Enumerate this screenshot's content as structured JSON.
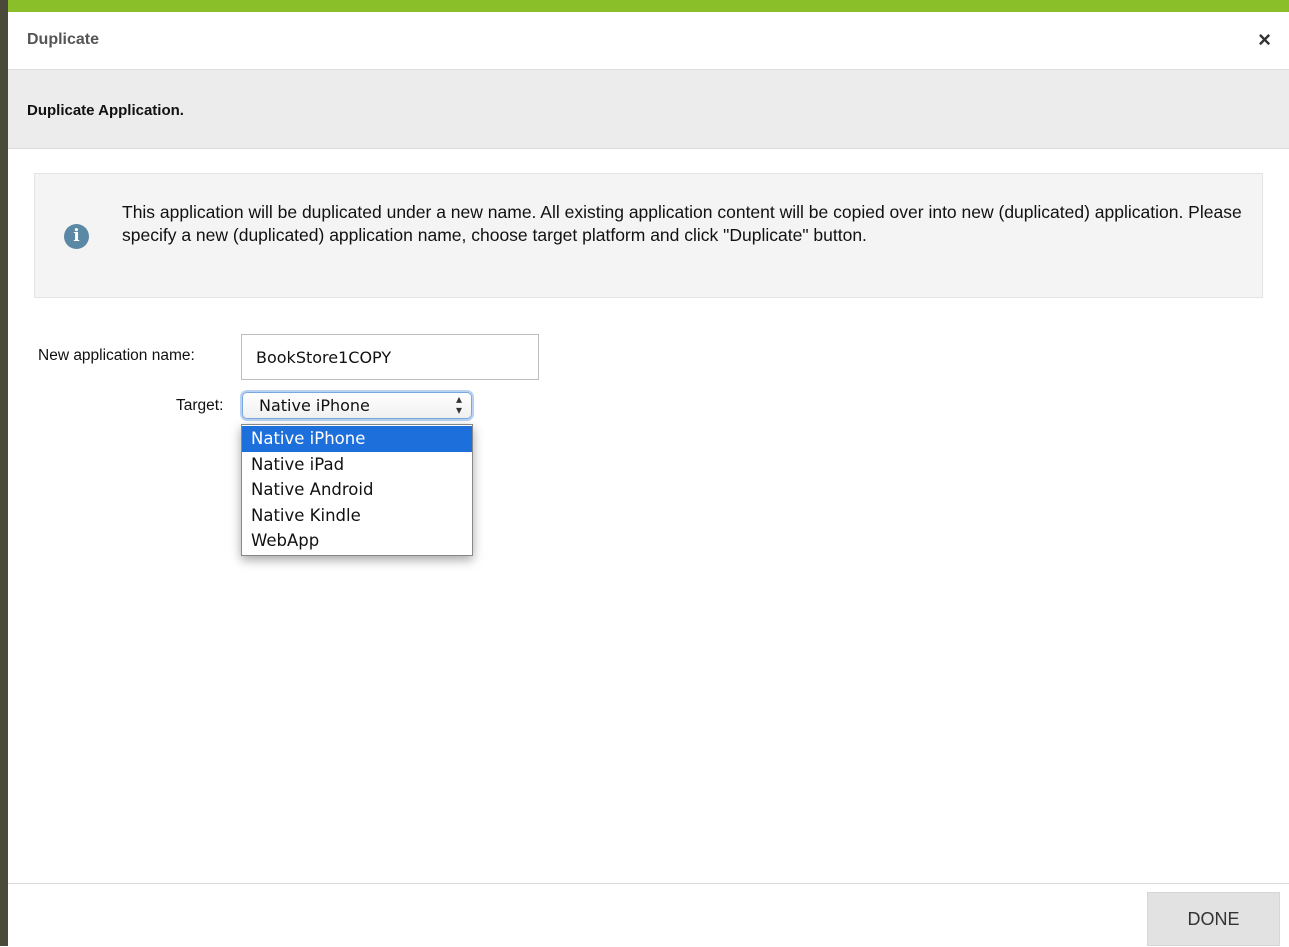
{
  "dialog": {
    "title": "Duplicate",
    "close_glyph": "×",
    "subtitle": "Duplicate Application."
  },
  "info": {
    "icon": "info-icon",
    "icon_glyph": "i",
    "text": "This application will be duplicated under a new name. All existing application content will be copied over into new (duplicated) application. Please specify a new (duplicated) application name, choose target platform and click \"Duplicate\" button."
  },
  "form": {
    "name_label": "New application name:",
    "name_value": "BookStore1COPY",
    "target_label": "Target:",
    "target_selected": "Native iPhone",
    "target_arrows": "⌃⌄",
    "target_options": [
      "Native iPhone",
      "Native iPad",
      "Native Android",
      "Native Kindle",
      "WebApp"
    ]
  },
  "footer": {
    "done_label": "DONE"
  },
  "colors": {
    "accent": "#8bbf2a",
    "info_icon": "#5b88a5",
    "selected_option": "#1d6fdc"
  }
}
